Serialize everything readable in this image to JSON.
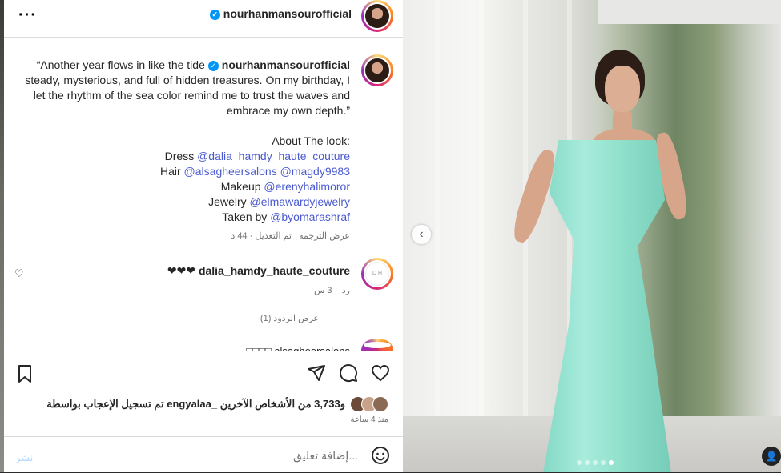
{
  "header": {
    "username": "nourhanmansourofficial",
    "more_icon": "more-horizontal-icon"
  },
  "caption": {
    "username": "nourhanmansourofficial",
    "lines": [
      "“Another year flows in like the tide",
      "steady, mysterious, and full of hidden treasures. On my birthday, I",
      "let the rhythm of the sea color remind me to trust the waves and",
      "embrace my own depth.”"
    ],
    "about": "About The look:",
    "credits": [
      {
        "label": "Dress",
        "handles": [
          "@dalia_hamdy_haute_couture"
        ]
      },
      {
        "label": "Hair",
        "handles": [
          "@alsagheersalons",
          "@magdy9983"
        ]
      },
      {
        "label": "Makeup",
        "handles": [
          "@erenyhalimoror"
        ]
      },
      {
        "label": "Jewelry",
        "handles": [
          "@elmawardyjewelry"
        ]
      },
      {
        "label": "Taken by",
        "handles": [
          "@byomarashraf"
        ]
      }
    ],
    "edited_time": "تم التعديل · 44 د",
    "see_translation": "عرض الترجمة"
  },
  "comment": {
    "username": "dalia_hamdy_haute_couture",
    "text": "❤❤❤",
    "age": "3 س",
    "reply": "رد",
    "view_replies": "عرض الردود (1)"
  },
  "next_comment_peek": "□□□□ alsagheersalons",
  "likes": {
    "text": "تم تسجيل الإعجاب بواسطة engyalaa_ و3,733 من الأشخاص الآخرين",
    "time": "منذ 4 ساعة"
  },
  "comment_box": {
    "placeholder": "إضافة تعليق...",
    "post_label": "نشر"
  },
  "carousel": {
    "total": 5,
    "active_index": 4
  },
  "colors": {
    "accent": "#0095f6",
    "mention": "#4a5ad0",
    "dress": "#8fe0cb"
  }
}
